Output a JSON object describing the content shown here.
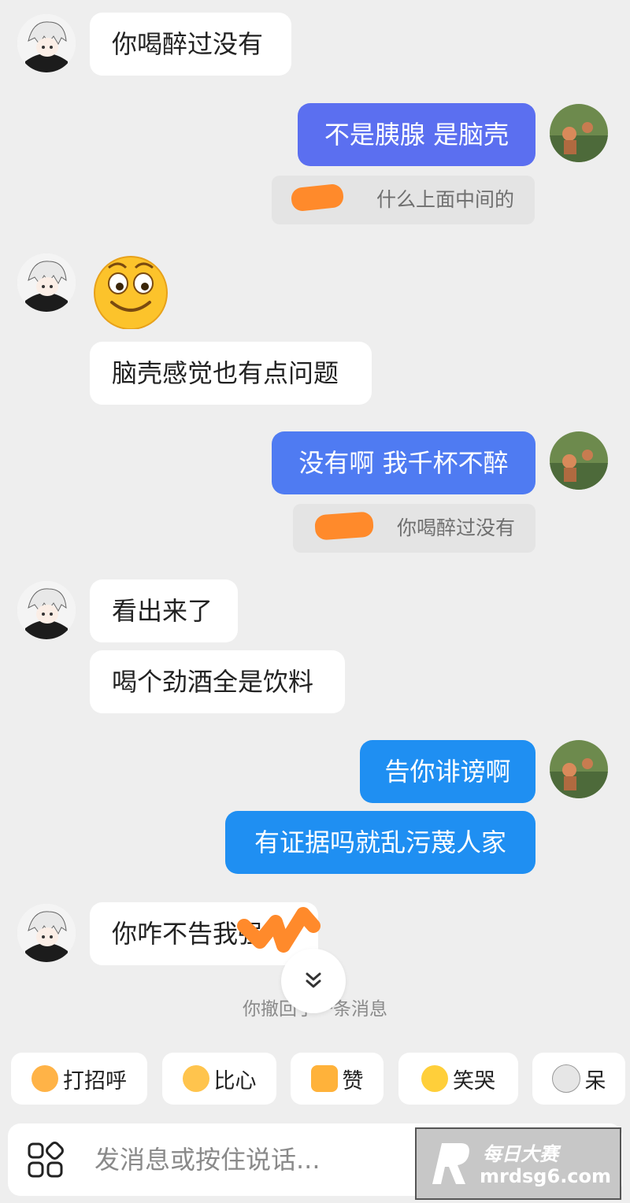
{
  "messages": {
    "m1": "你喝醉过没有",
    "m2": "不是胰腺 是脑壳",
    "q2": "什么上面中间的",
    "m4": "脑壳感觉也有点问题",
    "m5": "没有啊 我千杯不醉",
    "q5": "你喝醉过没有",
    "m6": "看出来了",
    "m7": "喝个劲酒全是饮料",
    "m8": "告你诽谤啊",
    "m9": "有证据吗就乱污蔑人家",
    "m10": "你咋不告我强"
  },
  "recall_notice": "你撤回了一条消息",
  "quick_replies": [
    "打招呼",
    "比心",
    "赞",
    "笑哭",
    "呆"
  ],
  "input": {
    "placeholder": "发消息或按住说话..."
  },
  "watermark": {
    "brand": "每日大赛",
    "url": "mrdsg6.com"
  },
  "colors": {
    "bubble_out_1": "#5b6ff0",
    "bubble_out_2": "#4f7bf2",
    "bubble_out_3": "#1f8ff2",
    "background": "#eeeeee"
  },
  "icons": {
    "avatar_left": "anime-white-hair-avatar",
    "avatar_right": "outdoor-photo-avatar",
    "smiley": "smiley-sticker",
    "scroll_down": "double-chevron-down-icon",
    "apps": "apps-grid-icon"
  }
}
